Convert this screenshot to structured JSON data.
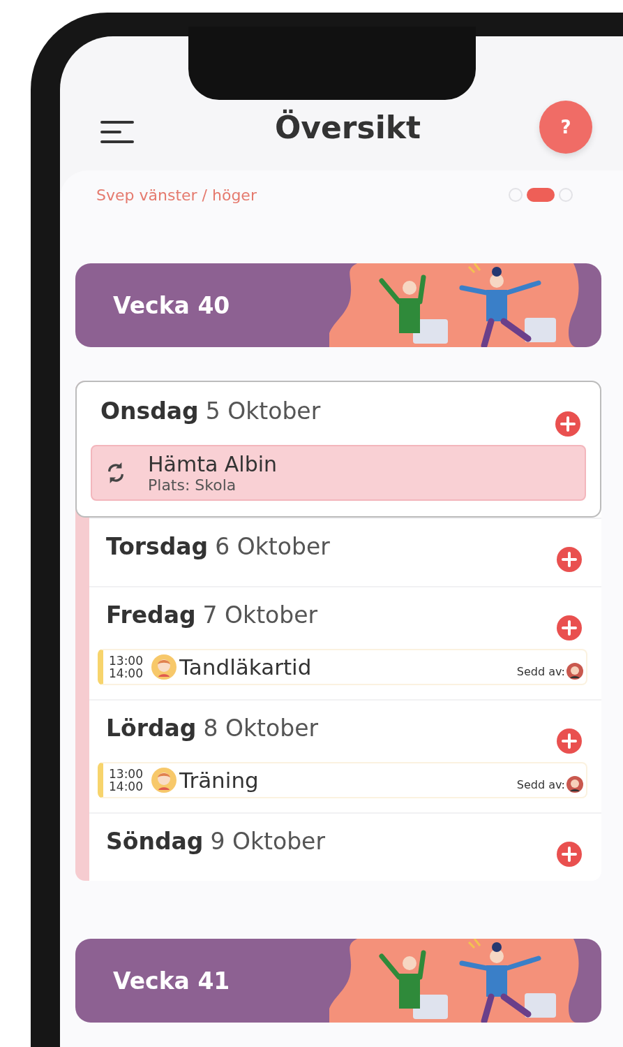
{
  "header": {
    "title": "Översikt",
    "help_label": "?"
  },
  "swipe_hint": "Svep vänster / höger",
  "pages": [
    {
      "selected": false
    },
    {
      "selected": true
    },
    {
      "selected": false
    }
  ],
  "weeks": [
    {
      "title": "Vecka 40",
      "days": [
        {
          "weekday": "Onsdag",
          "date": "5 Oktober",
          "selected": true,
          "events": [
            {
              "kind": "recurring",
              "title": "Hämta Albin",
              "place": "Plats: Skola"
            }
          ]
        },
        {
          "weekday": "Torsdag",
          "date": "6 Oktober",
          "selected": false
        },
        {
          "weekday": "Fredag",
          "date": "7 Oktober",
          "selected": false,
          "events": [
            {
              "kind": "timed",
              "start": "13:00",
              "end": "14:00",
              "title": "Tandläkartid",
              "seen_label": "Sedd av:"
            }
          ]
        },
        {
          "weekday": "Lördag",
          "date": "8 Oktober",
          "selected": false,
          "events": [
            {
              "kind": "timed",
              "start": "13:00",
              "end": "14:00",
              "title": "Träning",
              "seen_label": "Sedd av:"
            }
          ]
        },
        {
          "weekday": "Söndag",
          "date": "9 Oktober",
          "selected": false
        }
      ]
    },
    {
      "title": "Vecka 41"
    }
  ]
}
